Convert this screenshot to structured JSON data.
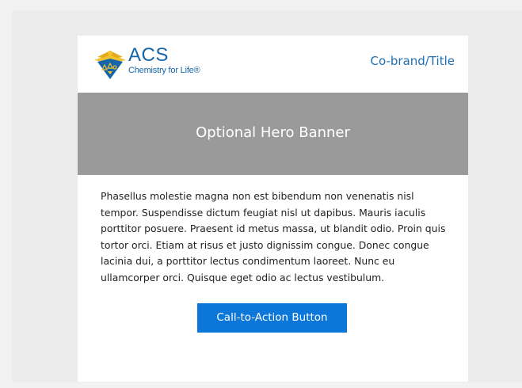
{
  "header": {
    "logo": {
      "wordmark": "ACS",
      "tagline": "Chemistry for Life®",
      "emblem_icon": "acs-eagle-emblem-icon"
    },
    "cobrand_title": "Co-brand/Title"
  },
  "hero": {
    "title": "Optional Hero Banner"
  },
  "content": {
    "paragraph": "Phasellus molestie magna non est bibendum non venenatis nisl tempor. Suspendisse dictum feugiat nisl ut dapibus. Mauris iaculis porttitor posuere. Praesent id metus massa, ut blandit odio. Proin quis tortor orci. Etiam at risus et justo dignissim congue. Donec congue lacinia dui, a porttitor lectus condimentum laoreet. Nunc eu ullamcorper orci. Quisque eget odio ac lectus vestibulum."
  },
  "cta": {
    "label": "Call-to-Action Button"
  },
  "colors": {
    "brand_blue": "#1665a8",
    "cta_blue": "#0c77d9",
    "hero_gray": "#9a9a9a",
    "emblem_gold": "#f2c230"
  }
}
